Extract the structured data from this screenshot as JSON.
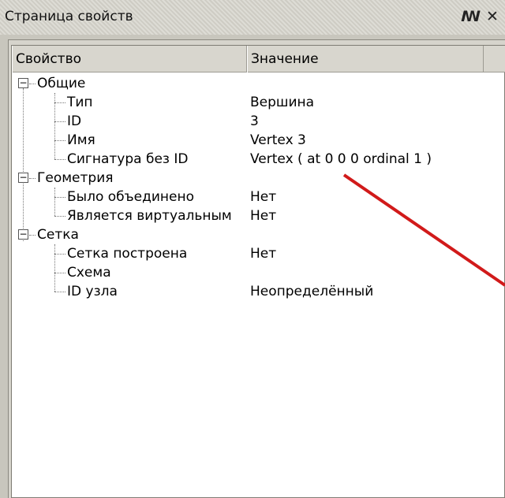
{
  "window": {
    "title": "Страница свойств",
    "float_icon": "float-window-icon",
    "close_icon": "close-icon"
  },
  "columns": {
    "property": "Свойство",
    "value": "Значение"
  },
  "groups": [
    {
      "label": "Общие",
      "expanded": true,
      "items": [
        {
          "label": "Тип",
          "value": "Вершина"
        },
        {
          "label": "ID",
          "value": "3"
        },
        {
          "label": "Имя",
          "value": "Vertex 3"
        },
        {
          "label": "Сигнатура без ID",
          "value": "Vertex ( at 0 0 0 ordinal 1 )"
        }
      ]
    },
    {
      "label": "Геометрия",
      "expanded": true,
      "items": [
        {
          "label": "Было объединено",
          "value": "Нет"
        },
        {
          "label": "Является виртуальным",
          "value": "Нет"
        }
      ]
    },
    {
      "label": "Сетка",
      "expanded": true,
      "items": [
        {
          "label": "Сетка построена",
          "value": "Нет"
        },
        {
          "label": "Схема",
          "value": ""
        },
        {
          "label": "ID узла",
          "value": "Неопределённый"
        }
      ]
    }
  ],
  "colors": {
    "annotation_arrow": "#d11a1a"
  }
}
